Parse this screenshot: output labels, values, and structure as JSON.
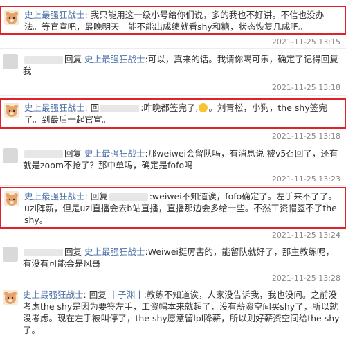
{
  "comments": [
    {
      "username": "史上最强狂战士",
      "reply_prefix": "",
      "reply_target": "",
      "content": "我只能用这一级小号给你们说，多的我也不好讲。不信也没办法。等官宣吧，最晚明天。能不能出成绩就看shy和糖，状态恢复几成吧。",
      "timestamp": "2021-11-25 13:15",
      "replies_label": "回复"
    },
    {
      "username": "",
      "reply_prefix": "回复",
      "reply_target": "史上最强狂战士",
      "content": ":可以，真来的话。我请你喝可乐，确定了记得回复我",
      "timestamp": "2021-11-25 13:18",
      "replies_label": "回复"
    },
    {
      "username": "史上最强狂战士",
      "reply_prefix": "回",
      "reply_target": "",
      "content_a": ":昨晚都签完了,",
      "content_b": "。刘青松，小狗，the shy签完了。到最后一起官宣。",
      "timestamp": "2021-11-25 13:18",
      "replies_label": "回复"
    },
    {
      "username": "",
      "reply_prefix": "回复",
      "reply_target": "史上最强狂战士",
      "content": ":那weiwei会留队吗，有消息说 被v5召回了，还有就是zoom不抢了？那中单吗，确定是fofo吗",
      "timestamp": "2021-11-25 13:23",
      "replies_label": "回复"
    },
    {
      "username": "史上最强狂战士",
      "reply_prefix": "回复",
      "reply_target": "",
      "content": ":weiwei不知道诶，fofo确定了。左手来不了了。uzi阵薪，但是uzi直播会去b站直播，直播那边会多给一些。不然工资帽签不了the shy。",
      "timestamp": "2021-11-25 13:24",
      "replies_label": "回复"
    },
    {
      "username": "",
      "reply_prefix": "回复",
      "reply_target": "史上最强狂战士",
      "content": ":Weiwei挺厉害的，能留队就好了，那主教练呢，有没有可能会是风哥",
      "timestamp": "2021-11-25 13:28",
      "replies_label": "回复"
    },
    {
      "username": "史上最强狂战士",
      "reply_prefix": "回复",
      "reply_target": "丨子渊丨",
      "content": ":教练不知道诶，人家没告诉我，我也没问。之前没考虑the shy是因为要签左手，工资帽本来就超了，没有薪资空间买shy了，所以就没考虑。现在左手被叫停了，the shy愿意留lpl降薪，所以则好薪资空间给the shy了。",
      "timestamp": "",
      "replies_label": "回复"
    }
  ],
  "colors": {
    "highlight_border": "#e0222a",
    "username": "#4a6fa5",
    "text": "#333333",
    "timestamp": "#888888"
  },
  "icons": {
    "bear_avatar": "bear-avatar-icon",
    "blurred_avatar": "blurred-avatar-icon",
    "emoji": "grinning-emoji-icon"
  }
}
